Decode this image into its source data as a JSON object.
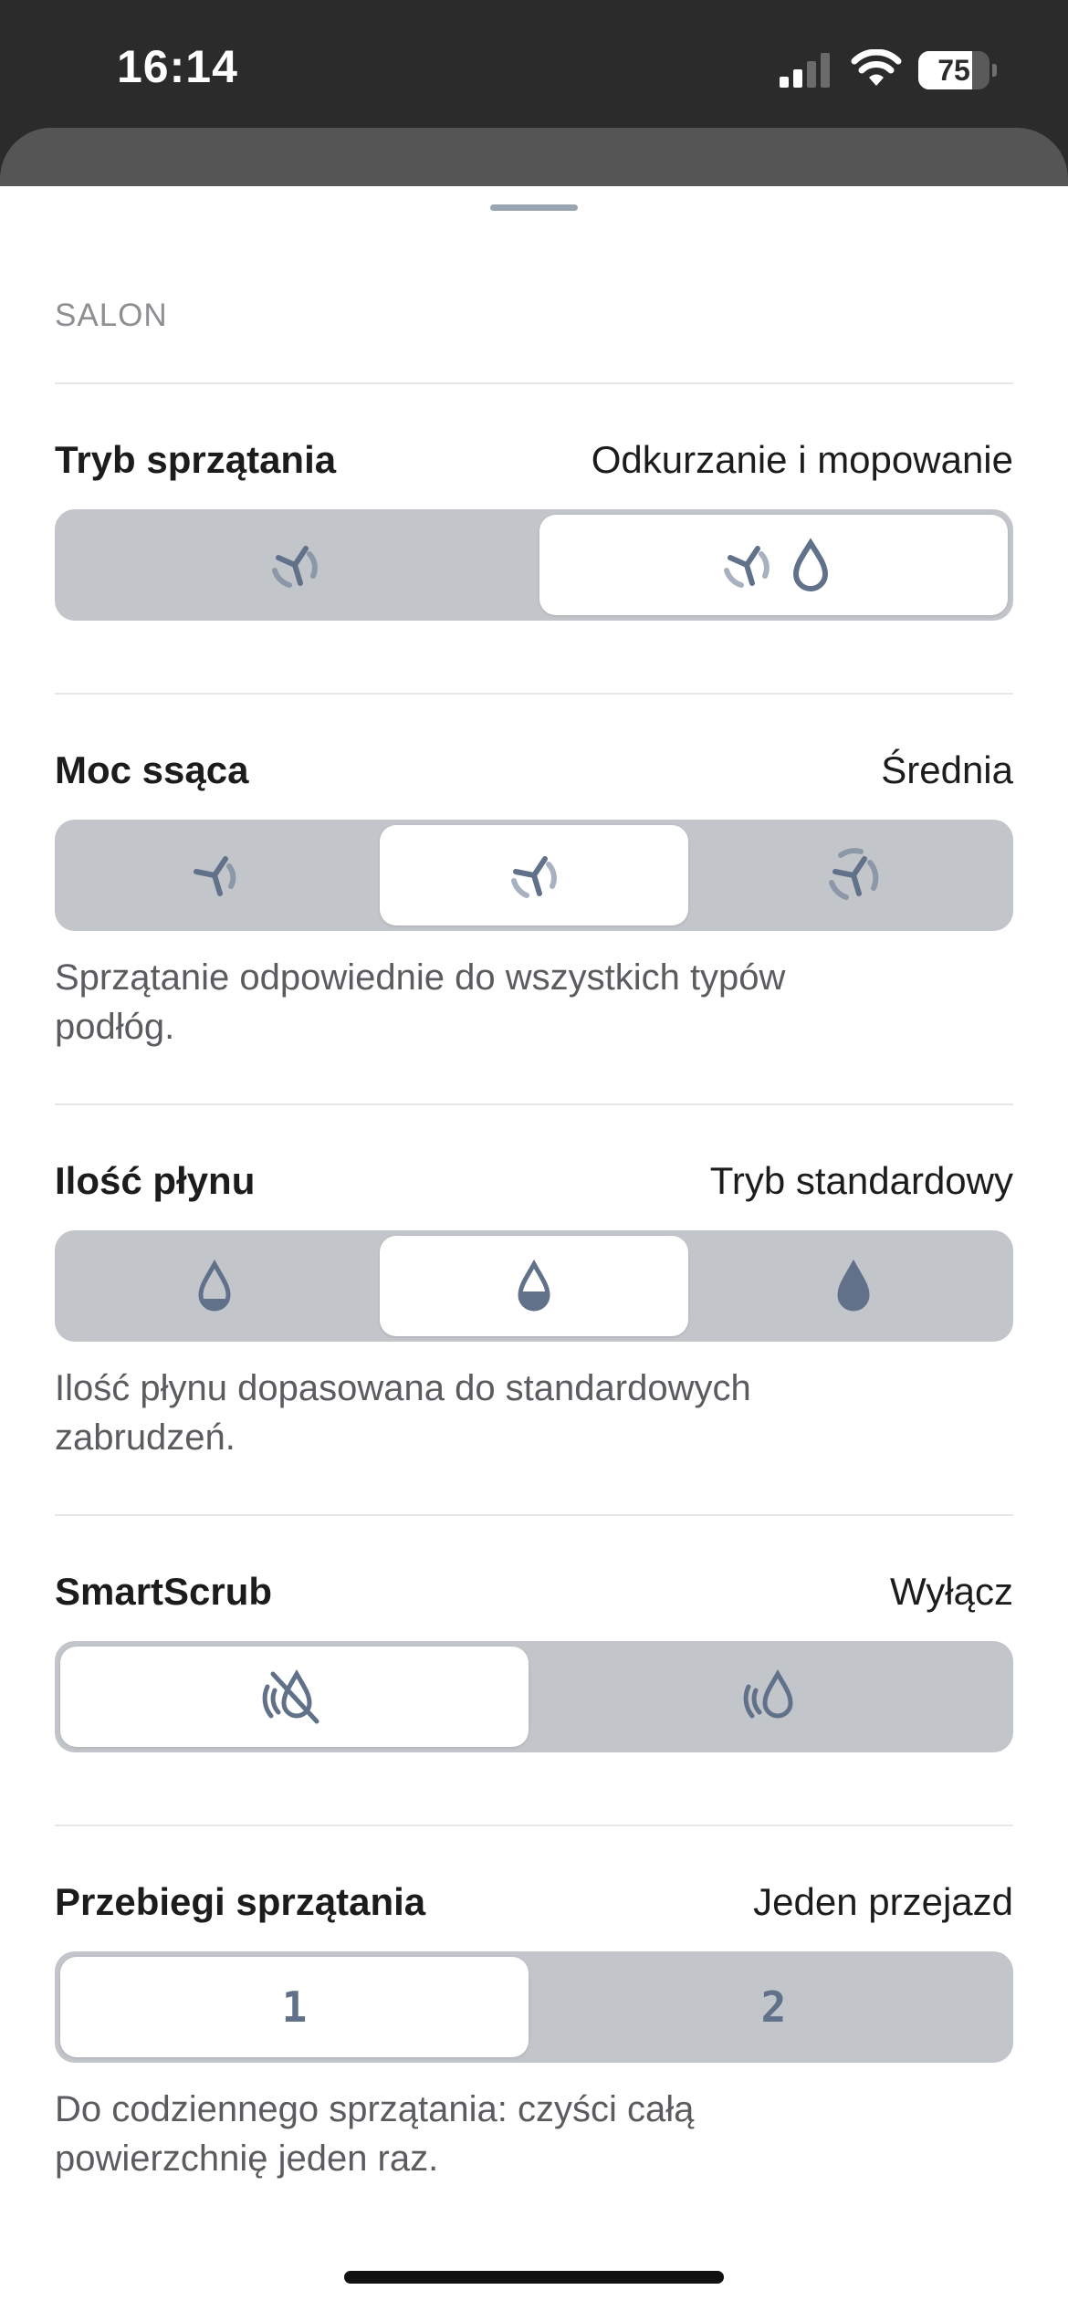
{
  "status_bar": {
    "time": "16:14",
    "battery_level": "75",
    "battery_fraction": 0.75,
    "signal_bars_active": 2,
    "signal_bars_total": 4
  },
  "room": {
    "name": "SALON"
  },
  "settings": {
    "cleaning_mode": {
      "title": "Tryb sprzątania",
      "value": "Odkurzanie i mopowanie",
      "options": [
        "vacuum-icon",
        "vacuum-and-mop-icon"
      ],
      "selected_index": 1
    },
    "suction_power": {
      "title": "Moc ssąca",
      "value": "Średnia",
      "options": [
        "suction-low-icon",
        "suction-medium-icon",
        "suction-high-icon"
      ],
      "selected_index": 1,
      "description": "Sprzątanie odpowiednie do wszystkich typów podłóg."
    },
    "water_amount": {
      "title": "Ilość płynu",
      "value": "Tryb standardowy",
      "options": [
        "water-low-icon",
        "water-medium-icon",
        "water-high-icon"
      ],
      "selected_index": 1,
      "description": "Ilość płynu dopasowana do standardowych zabrudzeń."
    },
    "smart_scrub": {
      "title": "SmartScrub",
      "value": "Wyłącz",
      "options": [
        "smartscrub-off-icon",
        "smartscrub-on-icon"
      ],
      "selected_index": 0
    },
    "cleaning_passes": {
      "title": "Przebiegi sprzątania",
      "value": "Jeden przejazd",
      "options": [
        "1",
        "2"
      ],
      "selected_index": 0,
      "description": "Do codziennego sprzątania: czyści całą powierzchnię jeden raz."
    }
  },
  "colors": {
    "icon": "#61718a",
    "segment_track": "#c2c6ca",
    "segment_selected": "#ffffff",
    "status_bar_bg": "#2b2b2b"
  }
}
